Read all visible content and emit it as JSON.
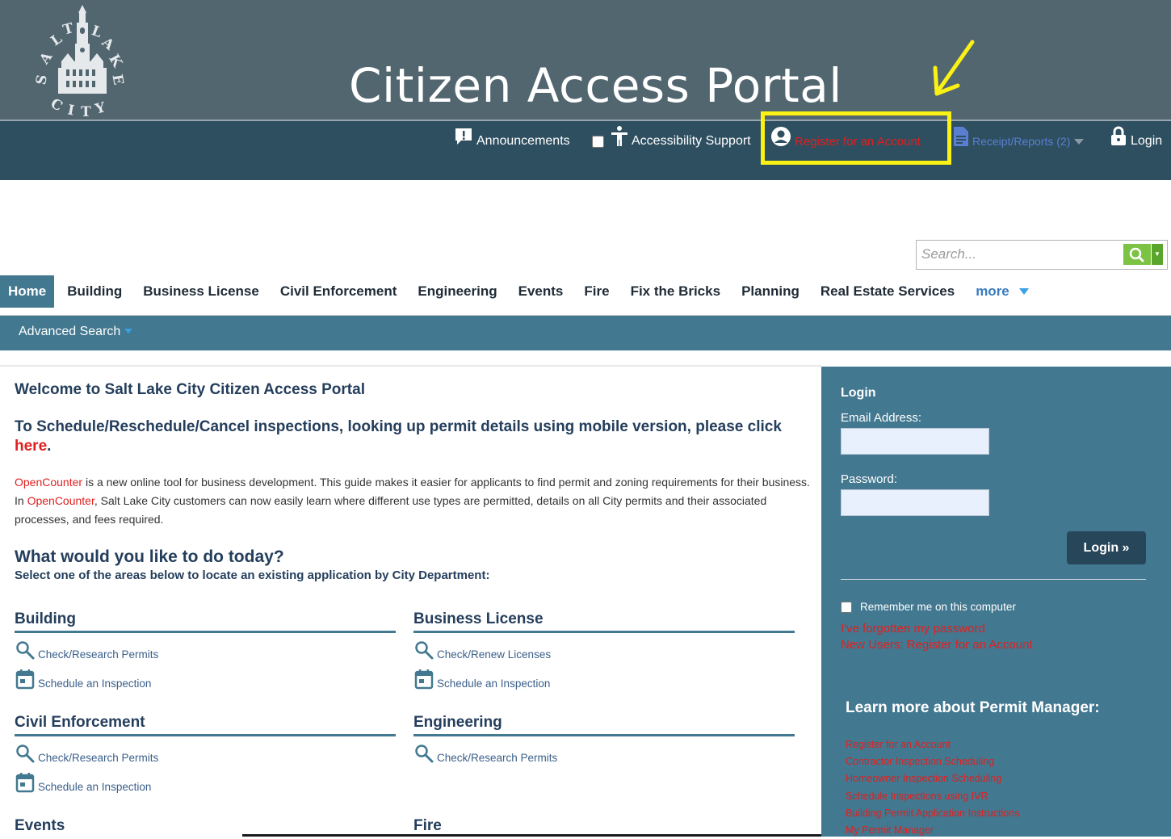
{
  "header": {
    "logo_text": "SALT LAKE CITY",
    "title": "Citizen Access Portal"
  },
  "utility_links": {
    "announcements": "Announcements",
    "accessibility": "Accessibility Support",
    "register": "Register for an Account",
    "receipts": "Receipt/Reports (2)",
    "login": "Login"
  },
  "search": {
    "placeholder": "Search..."
  },
  "nav": {
    "items": [
      "Home",
      "Building",
      "Business License",
      "Civil Enforcement",
      "Engineering",
      "Events",
      "Fire",
      "Fix the Bricks",
      "Planning",
      "Real Estate Services"
    ],
    "more": "more",
    "advanced_search": "Advanced Search"
  },
  "main": {
    "welcome": "Welcome to Salt Lake City Citizen Access Portal",
    "schedule_text": "To Schedule/Reschedule/Cancel inspections, looking up permit details using mobile version, please click",
    "schedule_link": "here",
    "schedule_period": ".",
    "intro": {
      "link1": "OpenCounter",
      "text1": " is a new online tool for business development. This guide makes it easier for applicants to find permit and zoning requirements for their business. In ",
      "link2": "OpenCounter",
      "text2": ", Salt Lake City customers can now easily learn where different use types are permitted, details on all City permits and their associated processes, and fees required."
    },
    "question_title": "What would you like to do today?",
    "question_sub": "Select one of the areas below to locate an existing application by City Department:",
    "departments": [
      {
        "title": "Building",
        "links": [
          "Check/Research Permits",
          "Schedule an Inspection"
        ]
      },
      {
        "title": "Business License",
        "links": [
          "Check/Renew Licenses",
          "Schedule an Inspection"
        ]
      },
      {
        "title": "Civil Enforcement",
        "links": [
          "Check/Research Permits",
          "Schedule an Inspection"
        ]
      },
      {
        "title": "Engineering",
        "links": [
          "Check/Research Permits"
        ]
      },
      {
        "title": "Events",
        "links": []
      },
      {
        "title": "Fire",
        "links": []
      }
    ]
  },
  "sidebar": {
    "login_title": "Login",
    "email_label": "Email Address:",
    "password_label": "Password:",
    "login_button": "Login »",
    "remember": "Remember me on this computer",
    "forgot": "I've forgotten my password",
    "new_users": "New Users: Register for an Account",
    "learn_title": "Learn more about Permit Manager:",
    "learn_links": [
      "Register for an Account",
      "Contractor Inspection Scheduling",
      "Homeowner Inspection Scheduling",
      "Schedule Inspections using IVR",
      "Building Permit Application Instructions",
      "My Permit Manager"
    ]
  },
  "colors": {
    "header_top": "#526670",
    "header_bar": "#2d4f60",
    "accent_blue": "#427890",
    "link_red": "#e02020",
    "highlight_yellow": "#fcf114"
  }
}
